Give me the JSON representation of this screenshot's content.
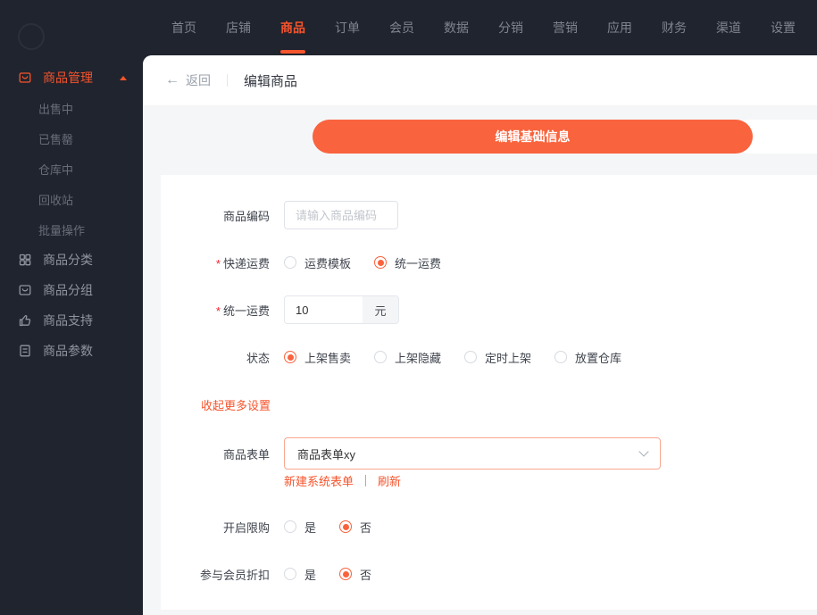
{
  "colors": {
    "accent": "#f5542c",
    "button": "#f9633d",
    "dark": "#20242e",
    "panel_bg": "#f5f6f7"
  },
  "topnav": {
    "items": [
      {
        "label": "首页",
        "active": false
      },
      {
        "label": "店铺",
        "active": false
      },
      {
        "label": "商品",
        "active": true
      },
      {
        "label": "订单",
        "active": false
      },
      {
        "label": "会员",
        "active": false
      },
      {
        "label": "数据",
        "active": false
      },
      {
        "label": "分销",
        "active": false
      },
      {
        "label": "营销",
        "active": false
      },
      {
        "label": "应用",
        "active": false
      },
      {
        "label": "财务",
        "active": false
      },
      {
        "label": "渠道",
        "active": false
      },
      {
        "label": "设置",
        "active": false
      }
    ]
  },
  "sidebar": {
    "management": {
      "label": "商品管理",
      "active": true,
      "expanded": true,
      "children": [
        "出售中",
        "已售罄",
        "仓库中",
        "回收站",
        "批量操作"
      ]
    },
    "items": [
      {
        "label": "商品分类",
        "icon": "grid-icon"
      },
      {
        "label": "商品分组",
        "icon": "box-icon"
      },
      {
        "label": "商品支持",
        "icon": "thumbs-up-icon"
      },
      {
        "label": "商品参数",
        "icon": "document-icon"
      }
    ]
  },
  "header": {
    "back_label": "返回",
    "back_icon": "arrow-left-icon",
    "title": "编辑商品"
  },
  "actions": {
    "primary_label": "编辑基础信息"
  },
  "form": {
    "product_code": {
      "label": "商品编码",
      "placeholder": "请输入商品编码",
      "value": ""
    },
    "shipping_fee": {
      "label": "快递运费",
      "required": "*",
      "options": [
        {
          "label": "运费模板",
          "checked": false
        },
        {
          "label": "统一运费",
          "checked": true
        }
      ]
    },
    "flat_fee": {
      "label": "统一运费",
      "required": "*",
      "value": "10",
      "unit": "元"
    },
    "status": {
      "label": "状态",
      "options": [
        {
          "label": "上架售卖",
          "checked": true
        },
        {
          "label": "上架隐藏",
          "checked": false
        },
        {
          "label": "定时上架",
          "checked": false
        },
        {
          "label": "放置仓库",
          "checked": false
        }
      ]
    },
    "collapse_link": "收起更多设置",
    "product_form": {
      "label": "商品表单",
      "value": "商品表单xy",
      "create_link": "新建系统表单",
      "refresh_link": "刷新"
    },
    "purchase_limit": {
      "label": "开启限购",
      "options": [
        {
          "label": "是",
          "checked": false
        },
        {
          "label": "否",
          "checked": true
        }
      ]
    },
    "member_discount": {
      "label": "参与会员折扣",
      "options": [
        {
          "label": "是",
          "checked": false
        },
        {
          "label": "否",
          "checked": true
        }
      ]
    }
  }
}
